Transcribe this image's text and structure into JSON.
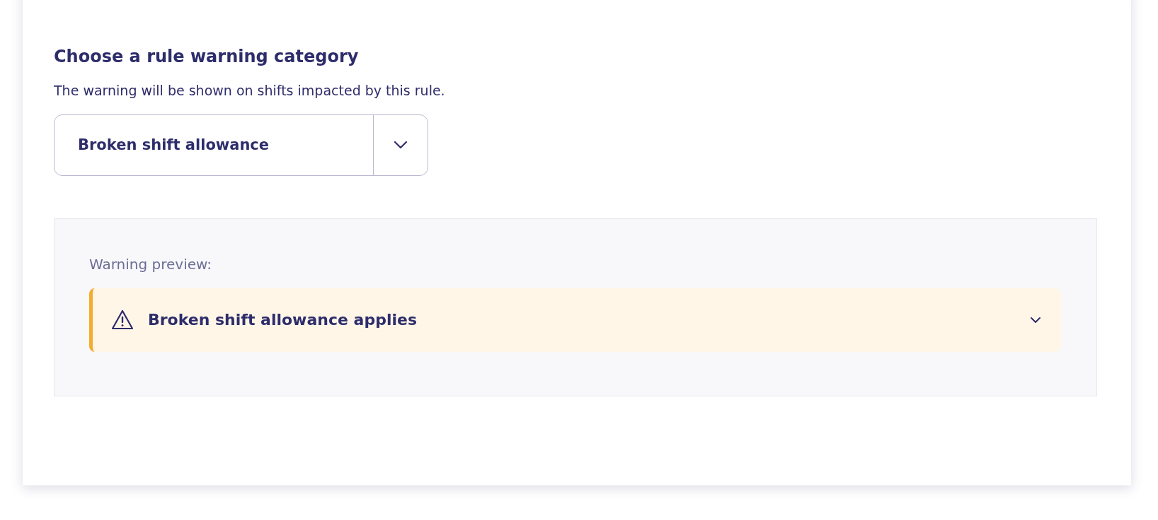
{
  "heading": "Choose a rule warning category",
  "description": "The warning will be shown on shifts impacted by this rule.",
  "category_select": {
    "value": "Broken shift allowance"
  },
  "preview": {
    "label": "Warning preview:",
    "warning": {
      "title": "Broken shift allowance applies",
      "expanded": false
    }
  }
}
